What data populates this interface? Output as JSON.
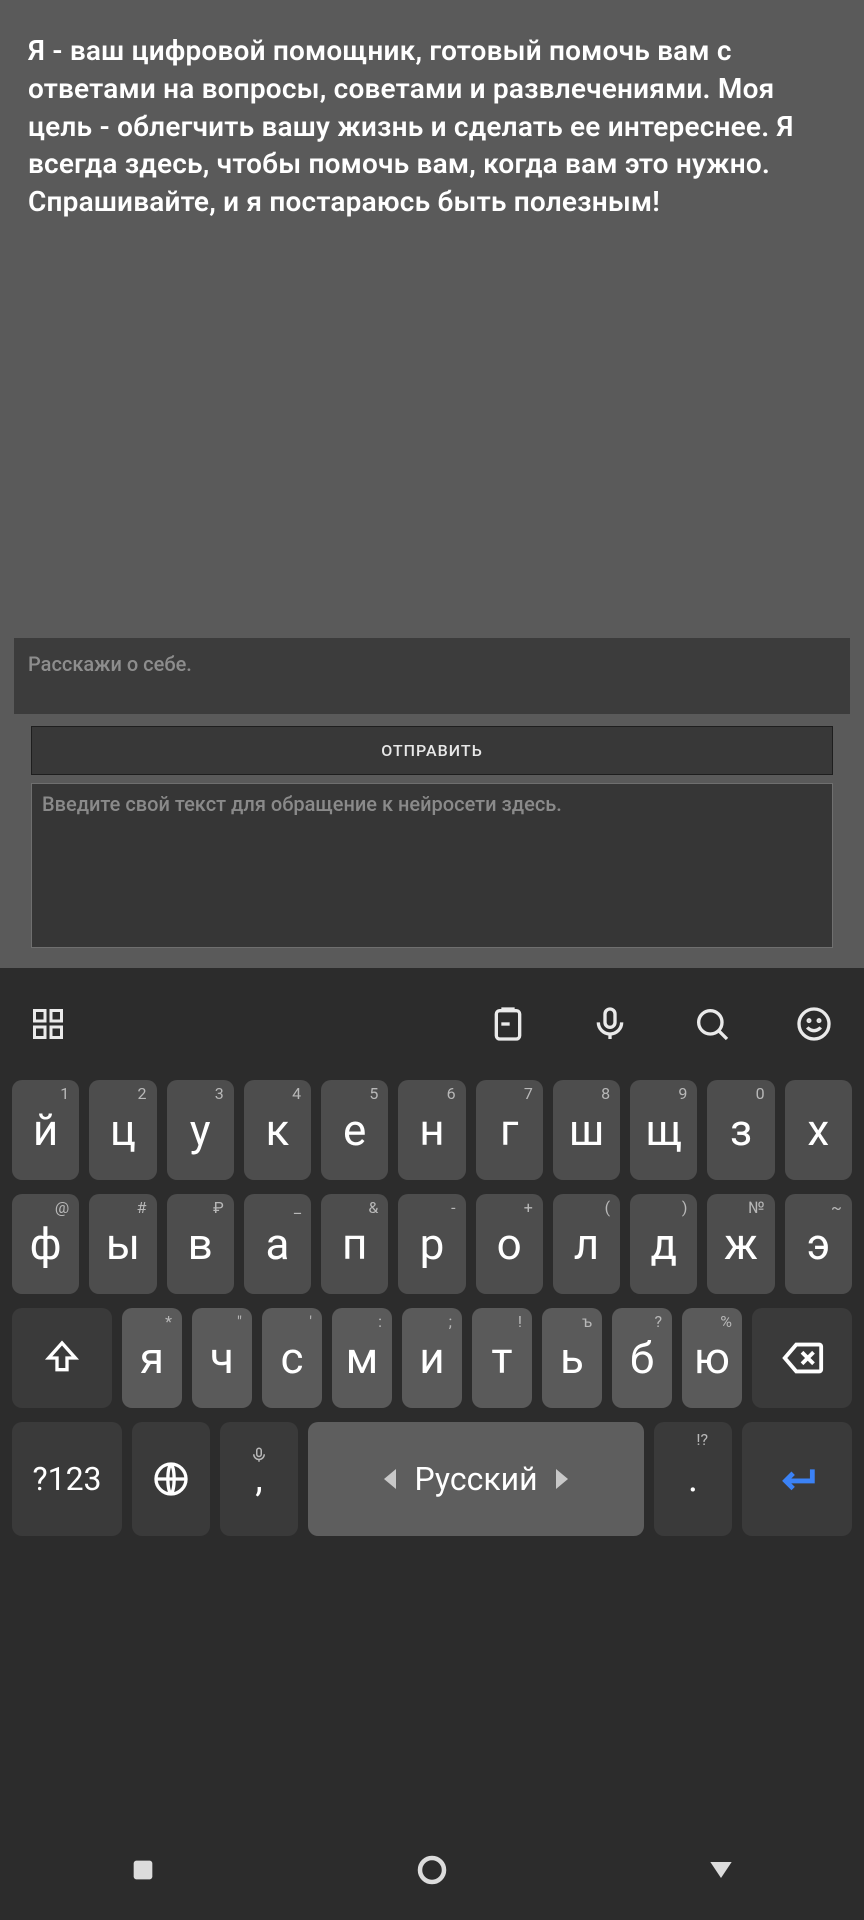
{
  "assistant_message": "Я - ваш цифровой помощник, готовый помочь вам с ответами на вопросы, советами и развлечениями. Моя цель - облегчить вашу жизнь и сделать ее интереснее. Я всегда здесь, чтобы помочь вам, когда вам это нужно. Спрашивайте, и я постараюсь быть полезным!",
  "suggestion_text": "Расскажи о себе.",
  "send_label": "ОТПРАВИТЬ",
  "input_placeholder": "Введите свой текст для обращение к нейросети здесь.",
  "keyboard": {
    "row1": [
      {
        "l": "й",
        "h": "1"
      },
      {
        "l": "ц",
        "h": "2"
      },
      {
        "l": "у",
        "h": "3"
      },
      {
        "l": "к",
        "h": "4"
      },
      {
        "l": "е",
        "h": "5"
      },
      {
        "l": "н",
        "h": "6"
      },
      {
        "l": "г",
        "h": "7"
      },
      {
        "l": "ш",
        "h": "8"
      },
      {
        "l": "щ",
        "h": "9"
      },
      {
        "l": "з",
        "h": "0"
      },
      {
        "l": "х",
        "h": ""
      }
    ],
    "row2": [
      {
        "l": "ф",
        "h": "@"
      },
      {
        "l": "ы",
        "h": "#"
      },
      {
        "l": "в",
        "h": "₽"
      },
      {
        "l": "а",
        "h": "_"
      },
      {
        "l": "п",
        "h": "&"
      },
      {
        "l": "р",
        "h": "-"
      },
      {
        "l": "о",
        "h": "+"
      },
      {
        "l": "л",
        "h": "("
      },
      {
        "l": "д",
        "h": ")"
      },
      {
        "l": "ж",
        "h": "№"
      },
      {
        "l": "э",
        "h": "~"
      }
    ],
    "row3": [
      {
        "l": "я",
        "h": "*"
      },
      {
        "l": "ч",
        "h": "\""
      },
      {
        "l": "с",
        "h": "'"
      },
      {
        "l": "м",
        "h": ":"
      },
      {
        "l": "и",
        "h": ";"
      },
      {
        "l": "т",
        "h": "!"
      },
      {
        "l": "ь",
        "h": "ъ"
      },
      {
        "l": "б",
        "h": "?"
      },
      {
        "l": "ю",
        "h": "%"
      }
    ],
    "sym_label": "?123",
    "space_label": "Русский",
    "comma": ",",
    "dot": ".",
    "dot_hint": "!?"
  }
}
